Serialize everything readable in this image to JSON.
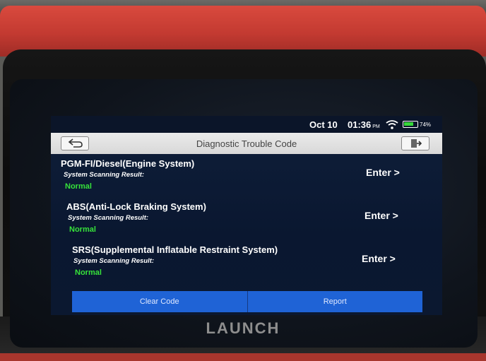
{
  "status_bar": {
    "date": "Oct 10",
    "time": "01:36",
    "ampm": "PM",
    "battery": "74%",
    "battery_level": 0.74
  },
  "header": {
    "title": "Diagnostic Trouble Code"
  },
  "systems": [
    {
      "name": "PGM-FI/Diesel(Engine System)",
      "label": "System Scanning Result:",
      "status": "Normal",
      "action": "Enter >"
    },
    {
      "name": "ABS(Anti-Lock Braking System)",
      "label": "System Scanning Result:",
      "status": "Normal",
      "action": "Enter >"
    },
    {
      "name": "SRS(Supplemental Inflatable Restraint System)",
      "label": "System Scanning Result:",
      "status": "Normal",
      "action": "Enter >"
    }
  ],
  "footer": {
    "clear_label": "Clear Code",
    "report_label": "Report"
  },
  "brand": "LAUNCH",
  "icons": {
    "back": "back-arrow-icon",
    "exit": "exit-icon",
    "wifi": "wifi-icon",
    "battery": "battery-icon"
  },
  "colors": {
    "screen_bg": "#0f1f3a",
    "status_normal": "#36e23a",
    "action_bar": "#1f63d6",
    "device_frame": "#c33a31"
  }
}
